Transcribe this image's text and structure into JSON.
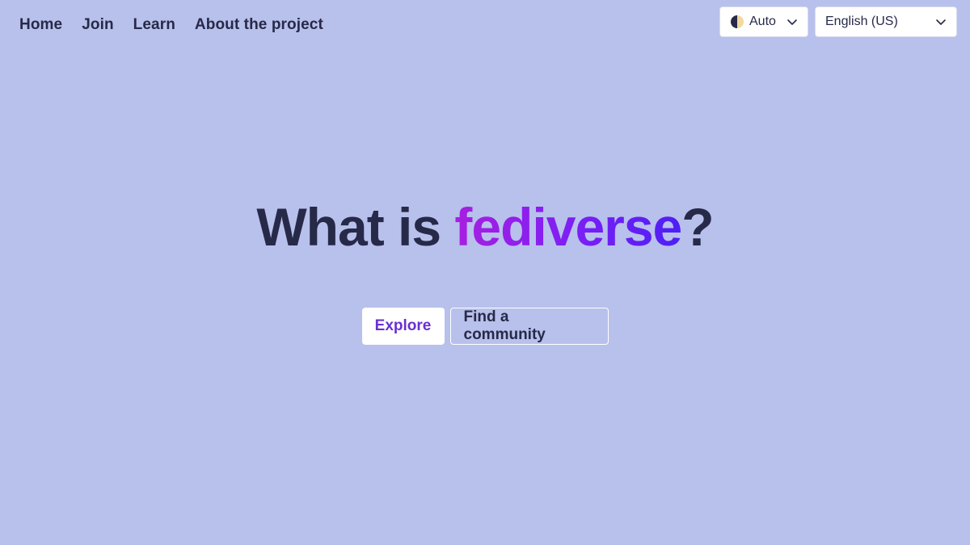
{
  "nav": {
    "items": [
      {
        "label": "Home"
      },
      {
        "label": "Join"
      },
      {
        "label": "Learn"
      },
      {
        "label": "About the project"
      }
    ]
  },
  "theme_select": {
    "value": "Auto",
    "icon": "half-moon-icon"
  },
  "language_select": {
    "value": "English (US)"
  },
  "hero": {
    "title_prefix": "What is ",
    "title_accent": "fediverse",
    "title_suffix": "?"
  },
  "cta": {
    "primary_label": "Explore",
    "secondary_label": "Find a community"
  },
  "colors": {
    "background": "#b8c0ec",
    "text": "#262a48",
    "accent_start": "#a81fe0",
    "accent_end": "#4d1ff5",
    "primary_button_text": "#6a2fd0"
  }
}
